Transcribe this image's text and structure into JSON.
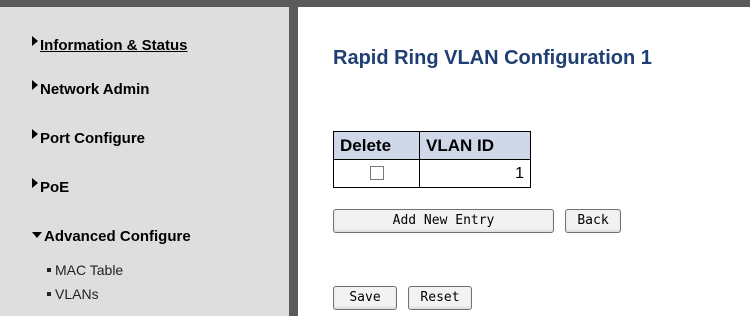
{
  "sidebar": {
    "items": [
      {
        "label": "Information & Status"
      },
      {
        "label": "Network Admin"
      },
      {
        "label": "Port Configure"
      },
      {
        "label": "PoE"
      },
      {
        "label": "Advanced Configure"
      }
    ],
    "subitems": [
      {
        "label": "MAC Table"
      },
      {
        "label": "VLANs"
      }
    ]
  },
  "main": {
    "title": "Rapid Ring VLAN Configuration 1",
    "table": {
      "headers": [
        "Delete",
        "VLAN ID"
      ],
      "rows": [
        {
          "delete_checked": false,
          "vlan_id": "1"
        }
      ]
    },
    "buttons": {
      "add_new_entry": "Add New Entry",
      "back": "Back",
      "save": "Save",
      "reset": "Reset"
    }
  },
  "colors": {
    "sidebar_bg": "#dedede",
    "frame": "#5a5a5a",
    "title": "#1f3f73",
    "table_header_bg": "#cfd8e8"
  }
}
